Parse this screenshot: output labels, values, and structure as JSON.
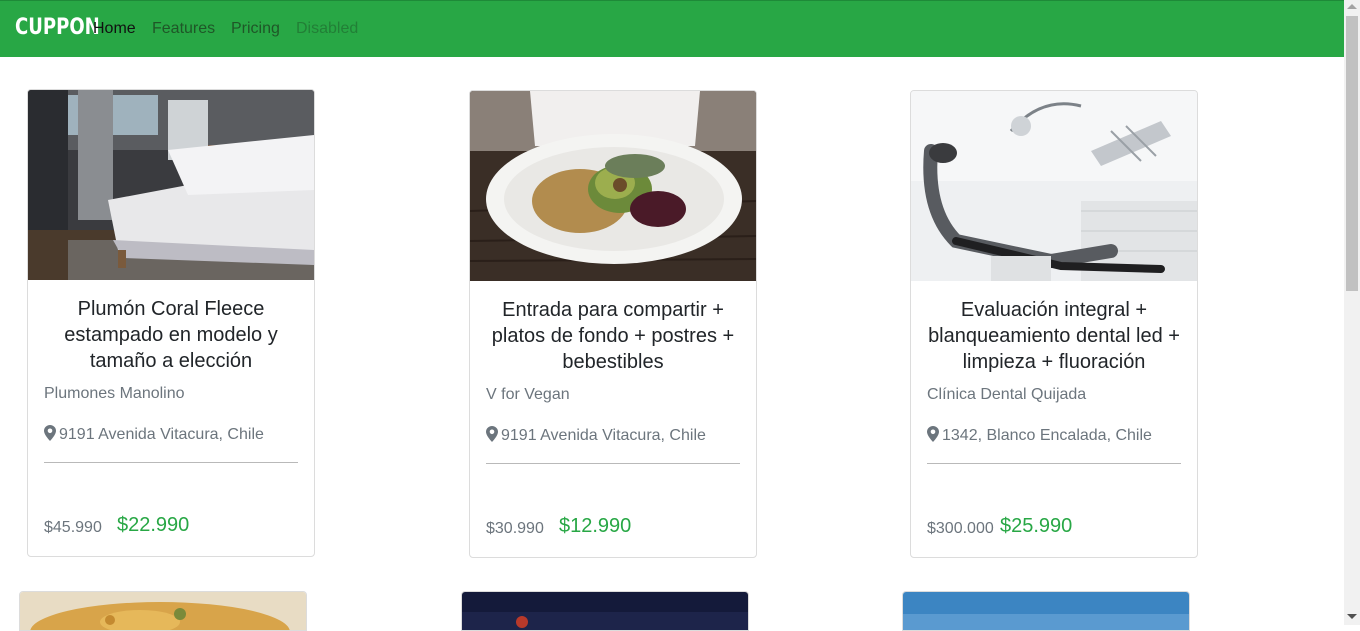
{
  "navbar": {
    "brand": "CUPPON",
    "links": [
      {
        "label": "Home"
      },
      {
        "label": "Features"
      },
      {
        "label": "Pricing"
      },
      {
        "label": "Disabled"
      }
    ],
    "color": "#28a745"
  },
  "cards": [
    {
      "image_icon": "bedroom-image",
      "title_lines": [
        "Plumón Coral Fleece",
        "estampado en modelo y",
        "tamaño a elección"
      ],
      "merchant": "Plumones Manolino",
      "location": "9191 Avenida Vitacura, Chile",
      "old_price": "$45.990",
      "new_price": "$22.990"
    },
    {
      "image_icon": "salad-plate-image",
      "title_lines": [
        "Entrada para compartir +",
        "platos de fondo + postres +",
        "bebestibles"
      ],
      "merchant": "V for Vegan",
      "location": "9191 Avenida Vitacura, Chile",
      "old_price": "$30.990",
      "new_price": "$12.990"
    },
    {
      "image_icon": "dental-chair-image",
      "title_lines": [
        "Evaluación integral +",
        "blanqueamiento dental led +",
        "limpieza + fluoración"
      ],
      "merchant": "Clínica Dental Quijada",
      "location": "1342, Blanco Encalada, Chile",
      "old_price": "$300.000",
      "new_price": "$25.990"
    }
  ],
  "accent_price_color": "#28a745"
}
